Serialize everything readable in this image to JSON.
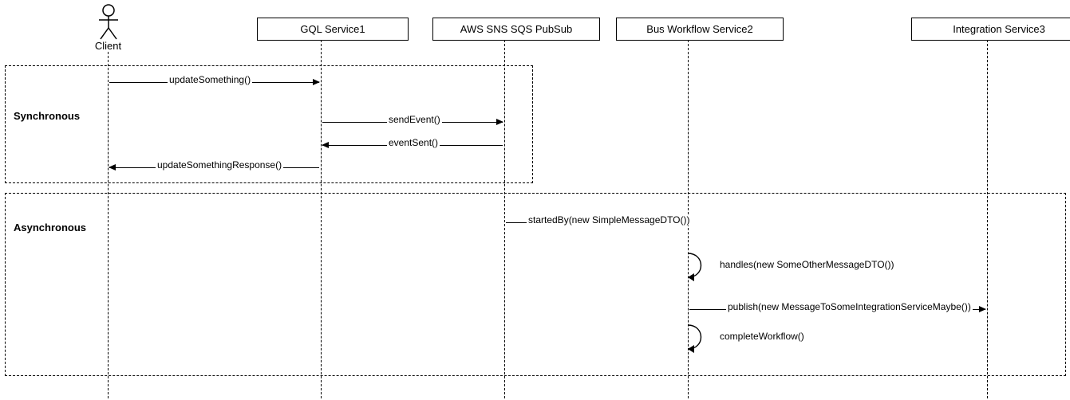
{
  "participants": {
    "client": {
      "label": "Client"
    },
    "gql": {
      "label": "GQL Service1"
    },
    "aws": {
      "label": "AWS SNS SQS PubSub"
    },
    "bus": {
      "label": "Bus Workflow Service2"
    },
    "int": {
      "label": "Integration Service3"
    }
  },
  "fragments": {
    "sync": {
      "label": "Synchronous"
    },
    "async": {
      "label": "Asynchronous"
    }
  },
  "messages": {
    "updateSomething": "updateSomething()",
    "sendEvent": "sendEvent()",
    "eventSent": "eventSent()",
    "updateSomethingResponse": "updateSomethingResponse()",
    "startedBy": "startedBy(new SimpleMessageDTO())",
    "handles": "handles(new SomeOtherMessageDTO())",
    "publish": "publish(new MessageToSomeIntegrationServiceMaybe())",
    "completeWorkflow": "completeWorkflow()"
  },
  "chart_data": {
    "type": "sequence_diagram",
    "participants": [
      {
        "id": "client",
        "label": "Client",
        "kind": "actor"
      },
      {
        "id": "gql",
        "label": "GQL Service1",
        "kind": "participant"
      },
      {
        "id": "aws",
        "label": "AWS SNS SQS PubSub",
        "kind": "participant"
      },
      {
        "id": "bus",
        "label": "Bus Workflow Service2",
        "kind": "participant"
      },
      {
        "id": "int",
        "label": "Integration Service3",
        "kind": "participant"
      }
    ],
    "fragments": [
      {
        "label": "Synchronous",
        "covers": [
          "client",
          "gql",
          "aws"
        ],
        "messages": [
          {
            "from": "client",
            "to": "gql",
            "label": "updateSomething()"
          },
          {
            "from": "gql",
            "to": "aws",
            "label": "sendEvent()"
          },
          {
            "from": "aws",
            "to": "gql",
            "label": "eventSent()"
          },
          {
            "from": "gql",
            "to": "client",
            "label": "updateSomethingResponse()"
          }
        ]
      },
      {
        "label": "Asynchronous",
        "covers": [
          "client",
          "gql",
          "aws",
          "bus",
          "int"
        ],
        "messages": [
          {
            "from": "aws",
            "to": "bus",
            "label": "startedBy(new SimpleMessageDTO())"
          },
          {
            "from": "bus",
            "to": "bus",
            "label": "handles(new SomeOtherMessageDTO())"
          },
          {
            "from": "bus",
            "to": "int",
            "label": "publish(new MessageToSomeIntegrationServiceMaybe())"
          },
          {
            "from": "bus",
            "to": "bus",
            "label": "completeWorkflow()"
          }
        ]
      }
    ]
  }
}
